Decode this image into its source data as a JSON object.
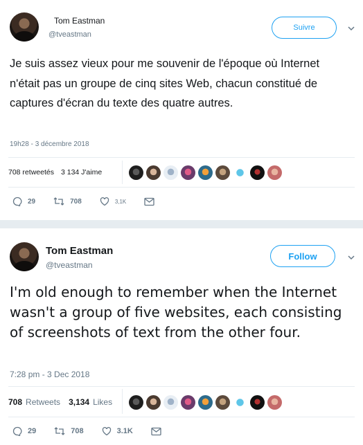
{
  "tweet_fr": {
    "author_name": "Tom Eastman",
    "author_handle": "@tveastman",
    "follow_label": "Suivre",
    "text": "Je suis assez vieux pour me souvenir de l'époque où Internet n'était pas un groupe de cinq sites Web, chacun constitué de captures d'écran du texte des quatre autres.",
    "timestamp": "19h28 - 3 décembre 2018",
    "retweets_text": "708 retweetés",
    "likes_text": "3 134 J'aime",
    "reply_count": "29",
    "retweet_count": "708",
    "like_count": "3,1K"
  },
  "tweet_en": {
    "author_name": "Tom Eastman",
    "author_handle": "@tveastman",
    "follow_label": "Follow",
    "text": "I'm old enough to remember when the Internet wasn't a group of five websites, each consisting of screenshots of text from the other four.",
    "timestamp": "7:28 pm - 3 Dec 2018",
    "retweets_num": "708",
    "retweets_label": "Retweets",
    "likes_num": "3,134",
    "likes_label": "Likes",
    "reply_count": "29",
    "retweet_count": "708",
    "like_count": "3.1K"
  },
  "liker_avatars": [
    "avatar-1",
    "avatar-2",
    "avatar-3",
    "avatar-4",
    "avatar-5",
    "avatar-6",
    "avatar-7",
    "avatar-8",
    "avatar-9"
  ],
  "icons": [
    "reply-icon",
    "retweet-icon",
    "like-icon",
    "message-icon",
    "chevron-down-icon"
  ],
  "colors": {
    "accent": "#1da1f2",
    "secondary_text": "#657786",
    "divider": "#e6ecf0"
  }
}
